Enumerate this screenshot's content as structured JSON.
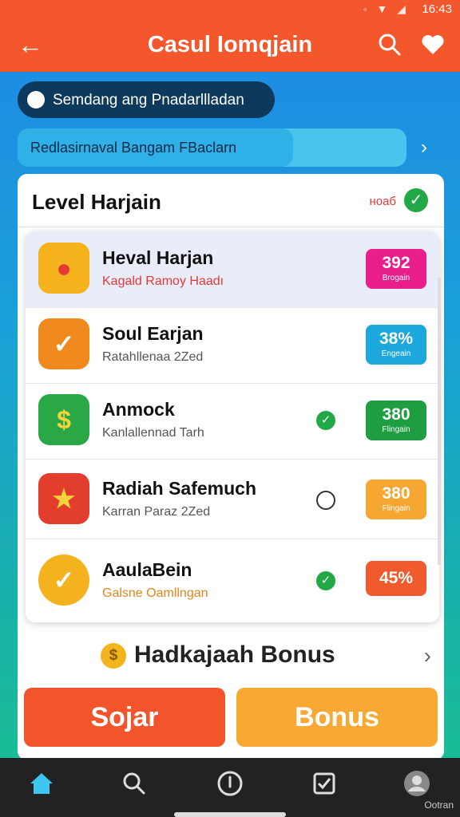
{
  "status_bar": {
    "time": "16:43",
    "icons": [
      "wifi-icon",
      "signal-icon",
      "battery-icon"
    ]
  },
  "app_bar": {
    "title": "Casul Iomqjain",
    "back_icon": "arrow-left-icon",
    "search_icon": "search-icon",
    "action_icon": "heart-icon"
  },
  "search": {
    "text": "Semdang ang Pnadarllladan"
  },
  "banner": {
    "text": "Redlasirnaval Bangam FBaclarn",
    "chevron_icon": "chevron-right-icon"
  },
  "card": {
    "title": "Level Harjain",
    "status_text": "ноаб",
    "check_icon": "check-circle-icon"
  },
  "items": [
    {
      "title": "Heval Harjan",
      "subtitle": "Kagald Ramoy Haadı",
      "badge_value": "392",
      "badge_label": "Brogain",
      "badge_color": "#e91e8c",
      "icon": "tomato-icon",
      "check": null,
      "selected": true,
      "subtitle_color": "#e53935"
    },
    {
      "title": "Soul Earjan",
      "subtitle": "Ratahllenaa 2Zed",
      "badge_value": "38%",
      "badge_label": "Engeain",
      "badge_color": "#1ca8dd",
      "icon": "chat-check-icon",
      "check": null,
      "selected": false,
      "subtitle_color": "#555555"
    },
    {
      "title": "Anmock",
      "subtitle": "Kanlallennad Tarh",
      "badge_value": "380",
      "badge_label": "Flingain",
      "badge_color": "#1e9e40",
      "icon": "dollar-coin-icon",
      "check": "check",
      "selected": false,
      "subtitle_color": "#555555"
    },
    {
      "title": "Radiah Safemuch",
      "subtitle": "Karran Paraz 2Zed",
      "badge_value": "380",
      "badge_label": "Flingain",
      "badge_color": "#f6a732",
      "icon": "gift-box-icon",
      "check": "spiral",
      "selected": false,
      "subtitle_color": "#555555"
    },
    {
      "title": "AaulaBein",
      "subtitle": "Galsne Oamllngan",
      "badge_value": "45%",
      "badge_label": "",
      "badge_color": "#f05a2c",
      "icon": "gold-badge-icon",
      "check": "check",
      "selected": false,
      "subtitle_color": "#e0851a"
    }
  ],
  "bonus_row": {
    "text": "Hadkajaah Bonus",
    "coin_icon": "coin-icon",
    "chevron_icon": "chevron-right-icon"
  },
  "buttons": {
    "primary": "Sojar",
    "secondary": "Bonus"
  },
  "nav": {
    "items": [
      "home-icon",
      "search-icon",
      "info-icon",
      "checkbox-icon",
      "profile-icon"
    ],
    "profile_label": "Ootran"
  },
  "colors": {
    "accent": "#f4572c",
    "secondary": "#f8a933",
    "nav": "#222222"
  }
}
